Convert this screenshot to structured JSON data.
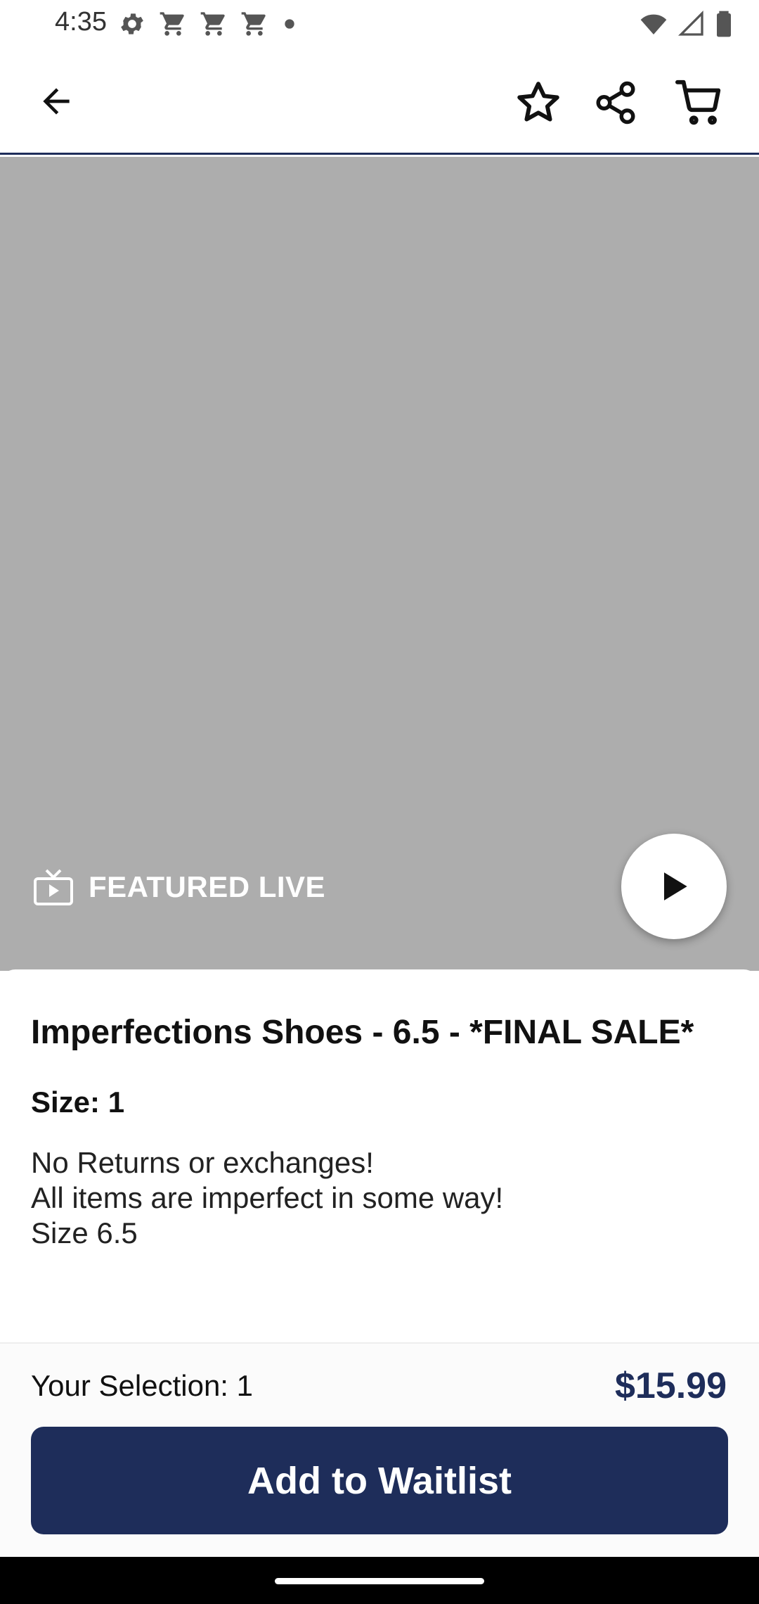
{
  "status_bar": {
    "time": "4:35",
    "left_icons": [
      "gear-icon",
      "cart-notification-icon",
      "cart-notification-icon",
      "cart-notification-icon",
      "dot-icon"
    ],
    "right_icons": [
      "wifi-icon",
      "signal-icon",
      "battery-icon"
    ]
  },
  "app_bar": {
    "back_icon": "arrow-back-icon",
    "favorite_icon": "star-outline-icon",
    "share_icon": "share-icon",
    "cart_icon": "cart-icon"
  },
  "media": {
    "featured_label": "FEATURED LIVE",
    "featured_icon": "tv-icon",
    "play_icon": "play-icon"
  },
  "product": {
    "title": "Imperfections Shoes - 6.5 - *FINAL SALE*",
    "size_label": "Size:",
    "size_value": "1",
    "description_lines": [
      "No Returns or exchanges!",
      "All items are imperfect in some way!",
      "Size 6.5"
    ]
  },
  "footer": {
    "selection_label": "Your Selection:",
    "selection_value": "1",
    "price": "$15.99",
    "cta_label": "Add to Waitlist"
  },
  "colors": {
    "brand_navy": "#1e2d5a",
    "media_placeholder": "#adadad"
  }
}
